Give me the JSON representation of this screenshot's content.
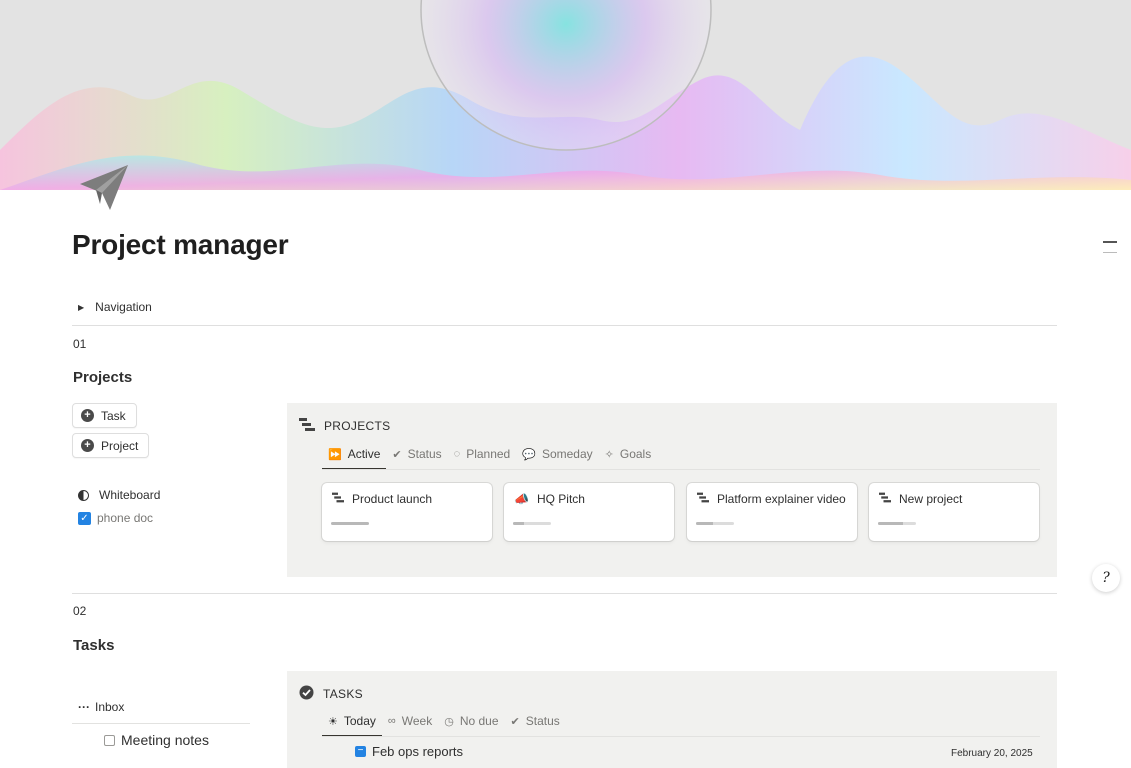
{
  "page": {
    "title": "Project manager",
    "icon": "paper-plane-icon"
  },
  "navigation": {
    "toggle_label": "Navigation"
  },
  "section1": {
    "number": "01",
    "title": "Projects",
    "buttons": [
      {
        "label": "Task",
        "icon": "plus-circle-icon"
      },
      {
        "label": "Project",
        "icon": "plus-circle-icon"
      }
    ],
    "whiteboard_label": "Whiteboard",
    "phone_doc_label": "phone doc",
    "panel": {
      "heading": "PROJECTS",
      "tabs": [
        {
          "label": "Active",
          "icon": "fast-forward-icon",
          "active": true
        },
        {
          "label": "Status",
          "icon": "check-circle-icon",
          "active": false
        },
        {
          "label": "Planned",
          "icon": "dashed-circle-icon",
          "active": false
        },
        {
          "label": "Someday",
          "icon": "speech-bubble-icon",
          "active": false
        },
        {
          "label": "Goals",
          "icon": "target-icon",
          "active": false
        }
      ],
      "cards": [
        {
          "title": "Product launch",
          "icon": "gantt-icon",
          "progress": 1.0
        },
        {
          "title": "HQ Pitch",
          "icon": "megaphone-icon",
          "progress": 0.3
        },
        {
          "title": "Platform explainer video",
          "icon": "gantt-icon",
          "progress": 0.45
        },
        {
          "title": "New project",
          "icon": "gantt-icon",
          "progress": 0.65
        }
      ]
    }
  },
  "section2": {
    "number": "02",
    "title": "Tasks",
    "inbox_label": "Inbox",
    "inbox_items": [
      {
        "label": "Meeting notes",
        "checked": false
      }
    ],
    "panel": {
      "heading": "TASKS",
      "tabs": [
        {
          "label": "Today",
          "icon": "sun-icon",
          "active": true
        },
        {
          "label": "Week",
          "icon": "glasses-icon",
          "active": false
        },
        {
          "label": "No due",
          "icon": "clock-icon",
          "active": false
        },
        {
          "label": "Status",
          "icon": "check-circle-icon",
          "active": false
        }
      ],
      "rows": [
        {
          "title": "Feb ops reports",
          "date": "February 20, 2025"
        }
      ]
    }
  },
  "help_button": {
    "label": "?"
  },
  "colors": {
    "accent": "#2383e2",
    "panel_bg": "#f1f1ef",
    "text": "#37352f"
  }
}
